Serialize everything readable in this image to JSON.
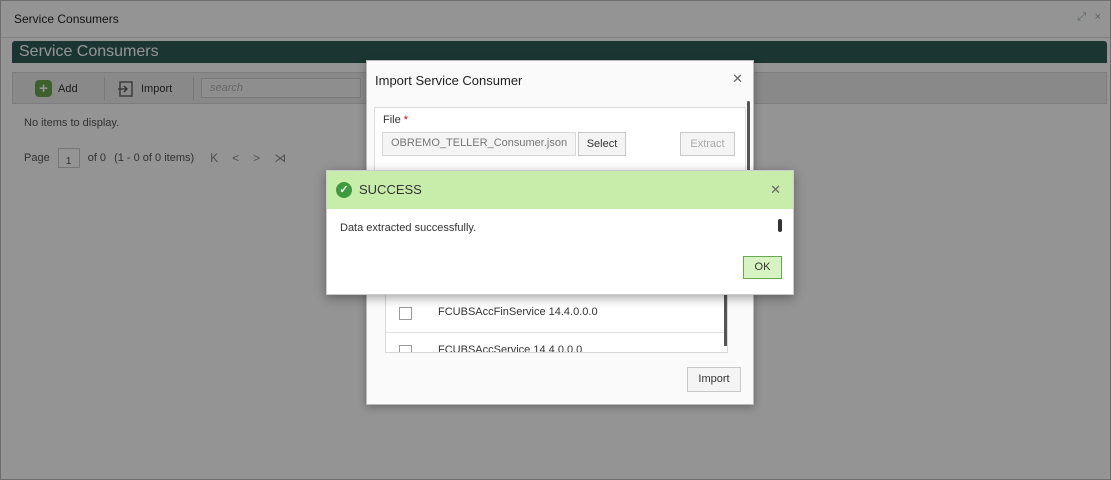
{
  "window": {
    "title": "Service Consumers",
    "controls": [
      "⤢",
      "×"
    ]
  },
  "header": {
    "title": "Service Consumers"
  },
  "toolbar": {
    "add_label": "Add",
    "import_label": "Import",
    "search_placeholder": "search"
  },
  "content": {
    "empty_message": "No items to display."
  },
  "pager": {
    "page_label": "Page",
    "page_value": "1",
    "of_text": "of 0",
    "range_text": "(1 - 0 of 0 items)",
    "nav": [
      "K",
      "<",
      ">",
      "⋊"
    ]
  },
  "import_dialog": {
    "title": "Import Service Consumer",
    "file_label": "File",
    "required_mark": "*",
    "file_value": "OBREMO_TELLER_Consumer.json",
    "select_label": "Select",
    "extract_label": "Extract",
    "items": [
      "FCUBSAccFinService 14.4.0.0.0",
      "FCUBSAccService 14.4.0.0.0"
    ],
    "import_label": "Import"
  },
  "success_dialog": {
    "title": "SUCCESS",
    "message": "Data extracted successfully.",
    "ok_label": "OK"
  },
  "colors": {
    "band": "#2f5d57",
    "success_header": "#c8ecaa",
    "success_icon": "#3f9b40",
    "ok_button": "#d8f3c2"
  }
}
